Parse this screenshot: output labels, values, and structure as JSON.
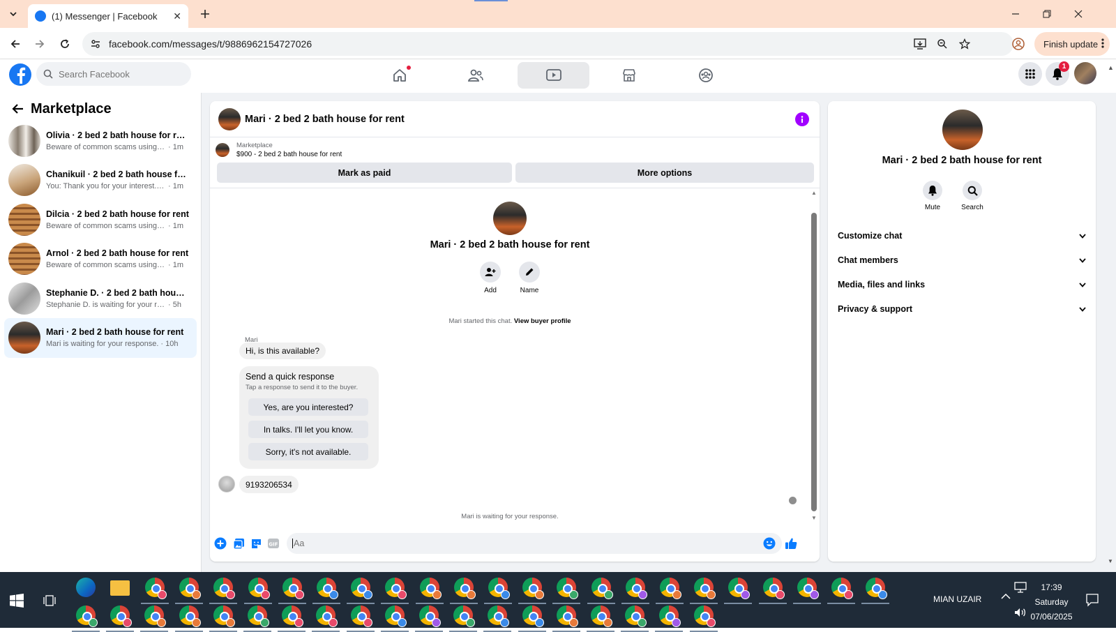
{
  "browser": {
    "tab_title": "(1) Messenger | Facebook",
    "url": "facebook.com/messages/t/9886962154727026",
    "finish_update": "Finish update"
  },
  "fb": {
    "search_placeholder": "Search Facebook",
    "notification_count": "1"
  },
  "sidebar": {
    "title": "Marketplace",
    "conversations": [
      {
        "name": "Olivia · 2 bed 2 bath house for rent",
        "preview": "Beware of common scams using pay...",
        "time": "· 1m",
        "thumb": "linear-gradient(90deg,#e8e4de,#8a7f72 30%,#f2eee8 55%,#6e6256 80%,#d8d2ca)"
      },
      {
        "name": "Chanikuil · 2 bed 2 bath house for ...",
        "preview": "You: Thank you for your interest. The ...",
        "time": "· 1m",
        "thumb": "linear-gradient(160deg,#f0ebe4,#c9a47a 55%,#8b5a2b)"
      },
      {
        "name": "Dilcia · 2 bed 2 bath house for rent",
        "preview": "Beware of common scams using pay...",
        "time": "· 1m",
        "thumb": "repeating-linear-gradient(180deg,#c98a4b 0 5px,#8a5328 5px 8px)"
      },
      {
        "name": "Arnol · 2 bed 2 bath house for rent",
        "preview": "Beware of common scams using pay...",
        "time": "· 1m",
        "thumb": "repeating-linear-gradient(180deg,#c98a4b 0 5px,#8a5328 5px 8px)"
      },
      {
        "name": "Stephanie D. · 2 bed 2 bath house ...",
        "preview": "Stephanie D. is waiting for your respo...",
        "time": "· 5h",
        "thumb": "linear-gradient(135deg,#ececec,#9b9b9b 50%,#e0e0e0)"
      },
      {
        "name": "Mari · 2 bed 2 bath house for rent",
        "preview": "Mari is waiting for your response.",
        "time": "· 10h",
        "thumb": "linear-gradient(180deg,#6b5a4a,#2b2b2b 40%,#c8622a 75%,#7a3a18)"
      }
    ]
  },
  "chat": {
    "title": "Mari · 2 bed 2 bath house for rent",
    "listing_label": "Marketplace",
    "listing_price": "$900 - 2 bed 2 bath house for rent",
    "mark_paid": "Mark as paid",
    "more_options": "More options",
    "intro_name": "Mari · 2 bed 2 bath house for rent",
    "add_label": "Add",
    "name_label": "Name",
    "started_text": "Mari started this chat.",
    "view_profile": "View buyer profile",
    "sender": "Mari",
    "first_message": "Hi, is this available?",
    "quick_title": "Send a quick response",
    "quick_sub": "Tap a response to send it to the buyer.",
    "quick_responses": [
      "Yes, are you interested?",
      "In talks. I'll let you know.",
      "Sorry, it's not available."
    ],
    "phone_message": "9193206534",
    "waiting": "Mari is waiting for your response.",
    "composer_placeholder": "Aa"
  },
  "details": {
    "name": "Mari · 2 bed 2 bath house for rent",
    "mute": "Mute",
    "search": "Search",
    "sections": [
      "Customize chat",
      "Chat members",
      "Media, files and links",
      "Privacy & support"
    ]
  },
  "taskbar": {
    "user": "MIAN UZAIR",
    "time": "17:39",
    "day": "Saturday",
    "date": "07/06/2025",
    "profile_colors_row1": [
      "#e84a6a",
      "#e87a3a",
      "#e84a6a",
      "#e84a6a",
      "#e84a6a",
      "#3a8ae8",
      "#3a8ae8",
      "#e84a6a",
      "#e87a3a",
      "#e87a3a",
      "#3a8ae8",
      "#e87a3a",
      "#3aa86a",
      "#3aa86a",
      "#a05ae8",
      "#e87a3a",
      "#e87a3a",
      "#a05ae8",
      "#e84a6a",
      "#a05ae8",
      "#e84a6a",
      "#3a8ae8"
    ],
    "profile_colors_row2": [
      "#3aa86a",
      "#e84a6a",
      "#e87a3a",
      "#e87a3a",
      "#e87a3a",
      "#3aa86a",
      "#e84a6a",
      "#e84a6a",
      "#e84a6a",
      "#3a8ae8",
      "#a05ae8",
      "#3aa86a",
      "#3a8ae8",
      "#3a8ae8",
      "#e87a3a",
      "#e87a3a",
      "#3aa86a",
      "#a05ae8",
      "#e84a6a"
    ]
  }
}
